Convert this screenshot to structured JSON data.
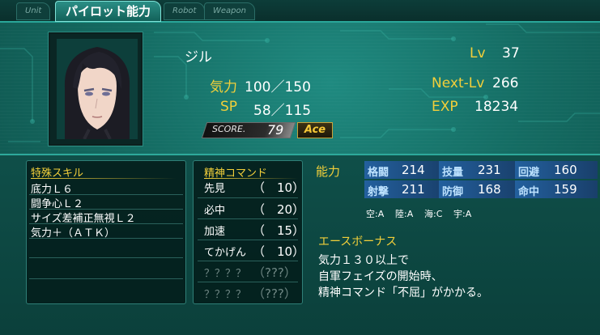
{
  "tabs": [
    {
      "label": "Unit",
      "active": false
    },
    {
      "label": "パイロット能力",
      "active": true
    },
    {
      "label": "Robot",
      "active": false
    },
    {
      "label": "Weapon",
      "active": false
    }
  ],
  "pilot": {
    "name": "ジル",
    "kiryoku_label": "気力",
    "kiryoku_value": "100／150",
    "sp_label": "SP",
    "sp_value": "58／115",
    "lv_label": "Lv",
    "lv_value": "37",
    "nextlv_label": "Next-Lv",
    "nextlv_value": "266",
    "exp_label": "EXP",
    "exp_value": "18234",
    "score_label": "SCORE.",
    "score_value": "79",
    "ace_badge": "Ace"
  },
  "skills": {
    "header": "特殊スキル",
    "items": [
      "底力Ｌ６",
      "闘争心Ｌ２",
      "サイズ差補正無視Ｌ２",
      "気力＋（ＡＴＫ）"
    ]
  },
  "seishin": {
    "header": "精神コマンド",
    "items": [
      {
        "name": "先見",
        "cost": "（　10）",
        "locked": false
      },
      {
        "name": "必中",
        "cost": "（　20）",
        "locked": false
      },
      {
        "name": "加速",
        "cost": "（　15）",
        "locked": false
      },
      {
        "name": "てかげん",
        "cost": "（　10）",
        "locked": false
      },
      {
        "name": "？？？？",
        "cost": "（???）",
        "locked": true
      },
      {
        "name": "？？？？",
        "cost": "（???）",
        "locked": true
      }
    ]
  },
  "abilities": {
    "header": "能力",
    "stats": [
      {
        "name": "格闘",
        "value": "214"
      },
      {
        "name": "技量",
        "value": "231"
      },
      {
        "name": "回避",
        "value": "160"
      },
      {
        "name": "射撃",
        "value": "211"
      },
      {
        "name": "防御",
        "value": "168"
      },
      {
        "name": "命中",
        "value": "159"
      }
    ],
    "terrain": [
      "空:A",
      "陸:A",
      "海:C",
      "宇:A"
    ]
  },
  "ace_bonus": {
    "title": "エースボーナス",
    "lines": [
      "気力１３０以上で",
      "自軍フェイズの開始時、",
      "精神コマンド「不屈」がかかる。"
    ]
  },
  "colors": {
    "accent_gold": "#f2cf3a",
    "teal_bg": "#146b62",
    "stat_blue": "#23609e"
  }
}
